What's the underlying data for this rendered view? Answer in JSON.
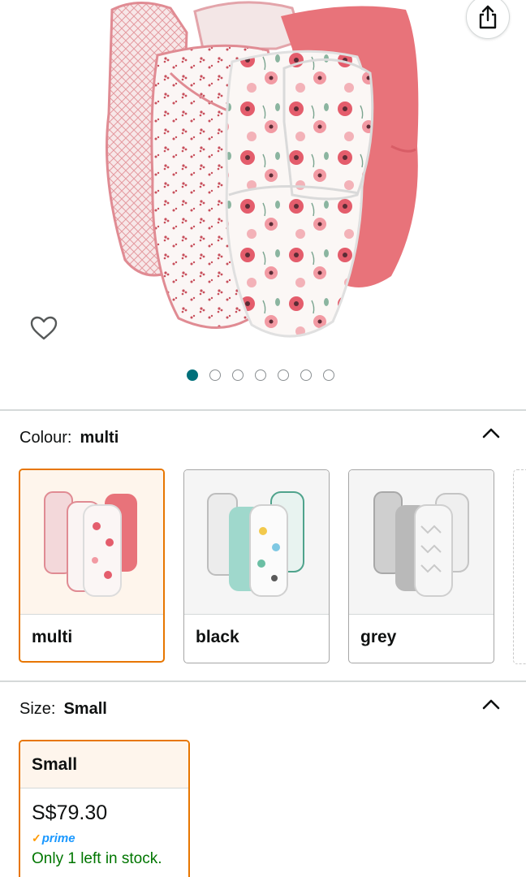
{
  "hero": {
    "carousel": {
      "count": 7,
      "active_index": 0
    }
  },
  "colour": {
    "label": "Colour:",
    "selected": "multi",
    "options": [
      {
        "name": "multi"
      },
      {
        "name": "black"
      },
      {
        "name": "grey"
      }
    ]
  },
  "size": {
    "label": "Size:",
    "selected": "Small",
    "options": [
      {
        "name": "Small",
        "price": "S$79.30",
        "prime_label": "prime",
        "stock": "Only 1 left in stock."
      }
    ]
  },
  "colors": {
    "accent_selected": "#e77600",
    "carousel_active": "#00707a",
    "in_stock": "#007600",
    "prime": "#1a98ff",
    "product_pink": "#e8737a"
  },
  "icons": [
    "share-icon",
    "heart-outline-icon",
    "chevron-up-icon",
    "prime-check-icon"
  ]
}
